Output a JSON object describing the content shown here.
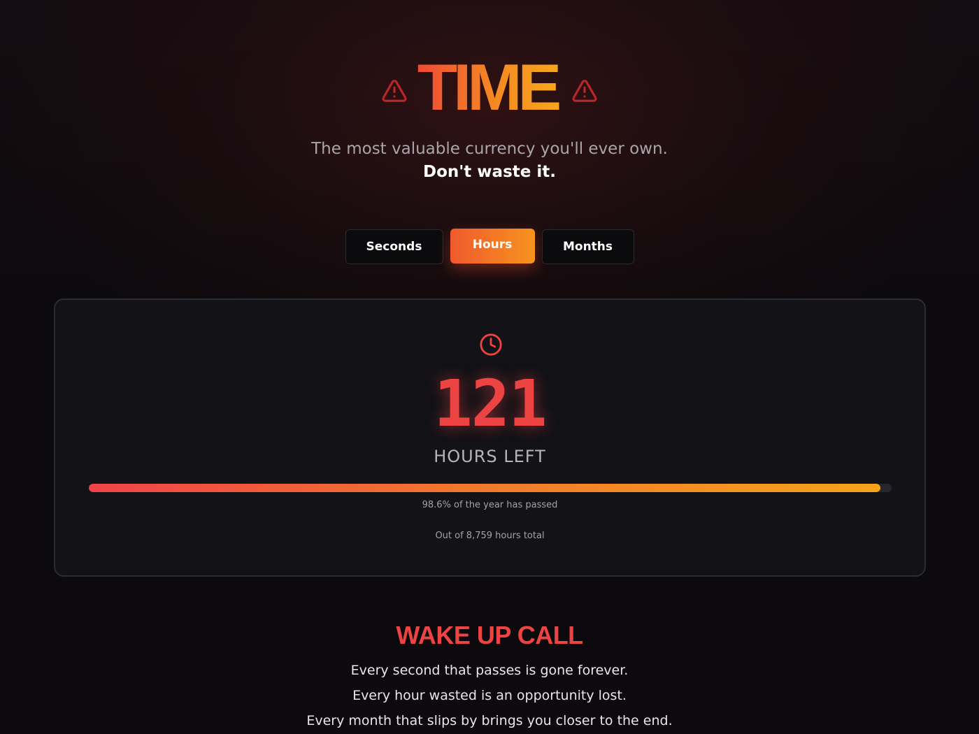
{
  "header": {
    "title": "TIME",
    "left_icon": "warning-triangle-icon",
    "right_icon": "warning-triangle-icon",
    "tagline": "The most valuable currency you'll ever own.",
    "tagline_bold": "Don't waste it."
  },
  "tabs": [
    {
      "label": "Seconds",
      "active": false
    },
    {
      "label": "Hours",
      "active": true
    },
    {
      "label": "Months",
      "active": false
    }
  ],
  "counter": {
    "icon": "clock-icon",
    "value": "121",
    "unit_label": "HOURS LEFT",
    "progress_fraction": 0.986,
    "progress_text": "98.6% of the year has passed",
    "total_text": "Out of 8,759 hours total"
  },
  "wake_up": {
    "title": "WAKE UP CALL",
    "lines": [
      "Every second that passes is gone forever.",
      "Every hour wasted is an opportunity lost.",
      "Every month that slips by brings you closer to the end."
    ]
  },
  "colors": {
    "accent_red": "#ee4343",
    "accent_orange": "#f7931e",
    "background": "#0c0a0d",
    "card": "#121217"
  }
}
